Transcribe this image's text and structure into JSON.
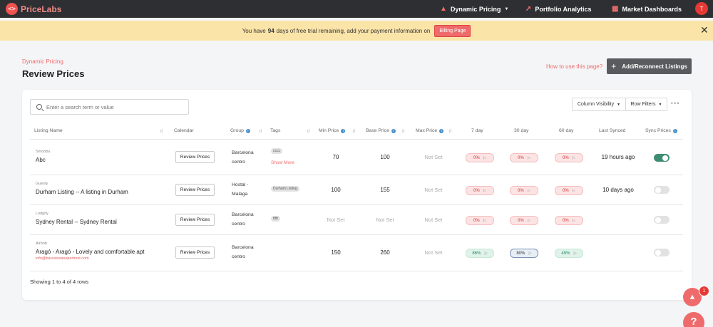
{
  "nav": {
    "logo_text": "PriceLabs",
    "items": [
      {
        "label": "Dynamic Pricing",
        "icon": "flame-icon",
        "has_dropdown": true
      },
      {
        "label": "Portfolio Analytics",
        "icon": "trend-icon"
      },
      {
        "label": "Market Dashboards",
        "icon": "grid-icon"
      }
    ],
    "avatar_initial": "T"
  },
  "banner": {
    "text_before": "You have",
    "days": "94",
    "text_after": "days of free trial remaining, add your payment information on",
    "button": "Billing Page"
  },
  "page": {
    "breadcrumb": "Dynamic Pricing",
    "title": "Review Prices",
    "howto_link": "How to use this page?",
    "add_button": "Add/Reconnect Listings"
  },
  "toolbar": {
    "search_placeholder": "Enter a search term or value",
    "column_visibility": "Column Visibility",
    "row_filters": "Row Filters"
  },
  "table": {
    "headers": {
      "listing_name": "Listing Name",
      "calendar": "Calendar",
      "group": "Group",
      "tags": "Tags",
      "min_price": "Min Price",
      "base_price": "Base Price",
      "max_price": "Max Price",
      "d7": "7 day",
      "d30": "30 day",
      "d60": "60 day",
      "last_synced": "Last Synced",
      "sync_prices": "Sync Prices"
    },
    "review_label": "Review Prices",
    "show_more": "Show More",
    "rows": [
      {
        "source": "Smoobu",
        "name": "Abc",
        "group": "Barcelona centro",
        "tag": "cccc",
        "min": "70",
        "base": "100",
        "max": "Not Set",
        "d7": "0%",
        "d30": "0%",
        "d60": "0%",
        "synced": "19 hours ago",
        "sync_on": true
      },
      {
        "source": "Guesty",
        "name": "Durham Listing -- A listing in Durham",
        "group": "Hostal - Malaga",
        "tag": "Durham Listing",
        "min": "100",
        "base": "155",
        "max": "Not Set",
        "d7": "0%",
        "d30": "0%",
        "d60": "0%",
        "synced": "10 days ago",
        "sync_on": false
      },
      {
        "source": "Lodgify",
        "name": "Sydney Rental -- Sydney Rental",
        "group": "Barcelona centro",
        "tag": "ttttt",
        "min": "Not Set",
        "base": "Not Set",
        "max": "Not Set",
        "d7": "0%",
        "d30": "0%",
        "d60": "0%",
        "synced": "",
        "sync_on": false
      },
      {
        "source": "Airbnb",
        "name": "Aragó - Aragó - Lovely and comfortable apt",
        "email": "info@barcelonasuperhost.com",
        "group": "Barcelona centro",
        "min": "150",
        "base": "260",
        "max": "Not Set",
        "d7": "86%",
        "d30": "80%",
        "d60": "49%",
        "synced": "",
        "sync_on": false
      }
    ],
    "footer": "Showing 1 to 4 of 4 rows"
  },
  "fab": {
    "badge": "1",
    "help": "?"
  },
  "colors": {
    "accent": "#ef6b6b",
    "nav_bg": "#2e2f33",
    "banner_bg": "#fbe4a8",
    "toggle_on": "#3e8d72"
  }
}
